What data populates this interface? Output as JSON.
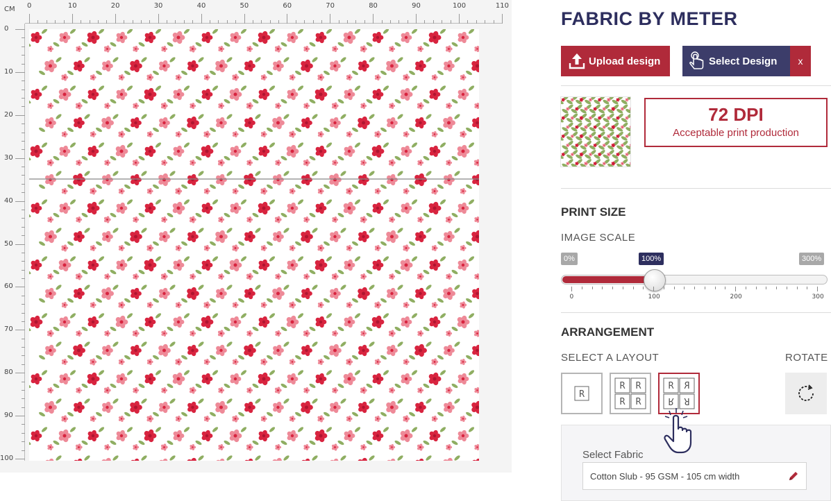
{
  "ruler": {
    "unit": "CM",
    "top_labels": [
      "0",
      "10",
      "20",
      "30",
      "40",
      "50",
      "60",
      "70",
      "80",
      "90",
      "100",
      "110"
    ],
    "left_labels": [
      "0",
      "10",
      "20",
      "30",
      "40",
      "50",
      "60",
      "70",
      "80",
      "90",
      "100"
    ]
  },
  "panel": {
    "title": "FABRIC BY METER",
    "upload_label": "Upload design",
    "select_label": "Select Design",
    "clear_label": "x",
    "dpi_value": "72 DPI",
    "dpi_note": "Acceptable print production",
    "print_size_heading": "PRINT SIZE",
    "image_scale_label": "IMAGE SCALE",
    "scale_min_badge": "0%",
    "scale_current_badge": "100%",
    "scale_max_badge": "300%",
    "scale_percent": 100,
    "scale_max": 300,
    "scale_ticks": [
      "0",
      "100",
      "200",
      "300"
    ],
    "arrangement_heading": "ARRANGEMENT",
    "layout_label": "SELECT A LAYOUT",
    "rotate_label": "ROTATE",
    "layout_letter": "R",
    "selected_layout": "mirror",
    "fabric_label": "Select Fabric",
    "fabric_value": "Cotton Slub - 95 GSM - 105 cm width"
  },
  "icons": {
    "upload": "upload-icon",
    "select": "hand-pointer-icon",
    "rotate": "rotate-icon",
    "edit": "pencil-icon",
    "cursor": "hand-cursor-icon"
  },
  "colors": {
    "brand_red": "#b02a3a",
    "brand_navy": "#2d2e5e",
    "flower_red": "#d8243f",
    "flower_pink": "#ee8a98",
    "leaf_green": "#8fae62"
  }
}
